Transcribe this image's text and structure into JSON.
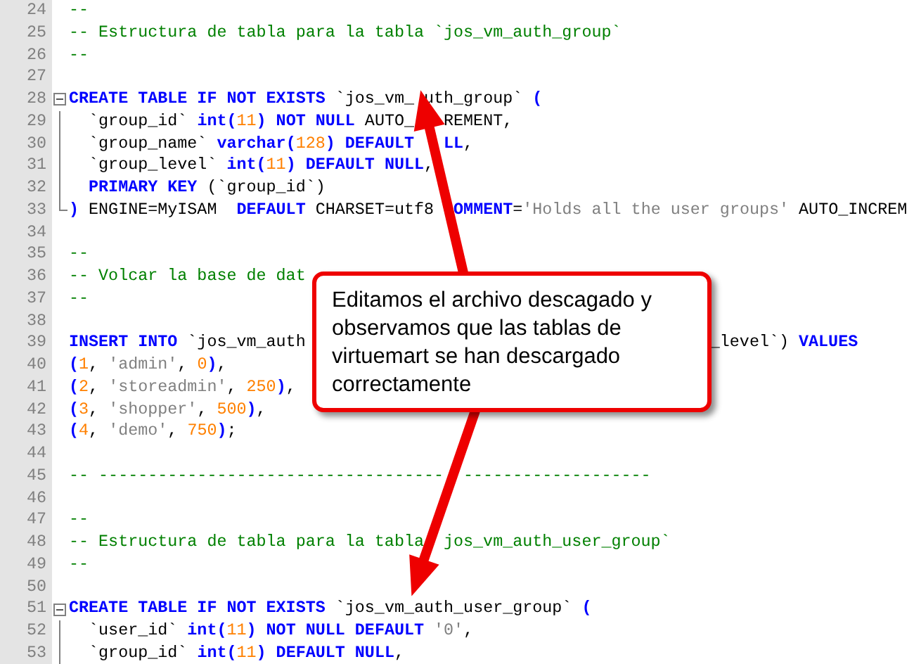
{
  "editor": {
    "lines": [
      {
        "number": "24",
        "tokens": [
          {
            "kind": "comment",
            "text": "--"
          }
        ]
      },
      {
        "number": "25",
        "tokens": [
          {
            "kind": "comment",
            "text": "-- Estructura de tabla para la tabla `jos_vm_auth_group`"
          }
        ]
      },
      {
        "number": "26",
        "tokens": [
          {
            "kind": "comment",
            "text": "--"
          }
        ]
      },
      {
        "number": "27"
      },
      {
        "number": "28",
        "fold_start": true,
        "tokens": [
          {
            "kind": "keyword",
            "text": "CREATE TABLE IF NOT EXISTS"
          },
          {
            "kind": "plain",
            "text": " `jos_vm_"
          },
          {
            "kind": "covered"
          },
          {
            "kind": "plain",
            "text": "uth_group` "
          },
          {
            "kind": "keyword",
            "text": "("
          }
        ]
      },
      {
        "number": "29",
        "fold_body": true,
        "tokens": [
          {
            "kind": "plain",
            "text": "  `group_id` "
          },
          {
            "kind": "keyword",
            "text": "int("
          },
          {
            "kind": "number",
            "text": "11"
          },
          {
            "kind": "keyword",
            "text": ") NOT NULL"
          },
          {
            "kind": "plain",
            "text": " AUTO_"
          },
          {
            "kind": "covered"
          },
          {
            "kind": "covered"
          },
          {
            "kind": "covered"
          },
          {
            "kind": "plain",
            "text": "REMENT,"
          }
        ]
      },
      {
        "number": "30",
        "fold_body": true,
        "tokens": [
          {
            "kind": "plain",
            "text": "  `group_name` "
          },
          {
            "kind": "keyword",
            "text": "varchar("
          },
          {
            "kind": "number",
            "text": "128"
          },
          {
            "kind": "keyword",
            "text": ") DEFAULT "
          },
          {
            "kind": "covered"
          },
          {
            "kind": "covered"
          },
          {
            "kind": "keyword",
            "text": "LL"
          },
          {
            "kind": "plain",
            "text": ","
          }
        ]
      },
      {
        "number": "31",
        "fold_body": true,
        "tokens": [
          {
            "kind": "plain",
            "text": "  `group_level` "
          },
          {
            "kind": "keyword",
            "text": "int("
          },
          {
            "kind": "number",
            "text": "11"
          },
          {
            "kind": "keyword",
            "text": ") DEFAULT NULL"
          },
          {
            "kind": "plain",
            "text": ","
          }
        ]
      },
      {
        "number": "32",
        "fold_body": true,
        "tokens": [
          {
            "kind": "keyword",
            "text": "  PRIMARY KEY"
          },
          {
            "kind": "plain",
            "text": " (`group_id`)"
          }
        ]
      },
      {
        "number": "33",
        "fold_end": true,
        "tokens": [
          {
            "kind": "keyword",
            "text": ")"
          },
          {
            "kind": "plain",
            "text": " ENGINE=MyISAM  "
          },
          {
            "kind": "keyword",
            "text": "DEFAULT"
          },
          {
            "kind": "plain",
            "text": " CHARSET=utf8 "
          },
          {
            "kind": "covered"
          },
          {
            "kind": "keyword",
            "text": "OMMENT"
          },
          {
            "kind": "plain",
            "text": "="
          },
          {
            "kind": "string",
            "text": "'Holds all the user groups'"
          },
          {
            "kind": "plain",
            "text": " AUTO_INCREM"
          }
        ]
      },
      {
        "number": "34"
      },
      {
        "number": "35",
        "tokens": [
          {
            "kind": "comment",
            "text": "--"
          }
        ]
      },
      {
        "number": "36",
        "tokens": [
          {
            "kind": "comment",
            "text": "-- Volcar la base de dat"
          }
        ]
      },
      {
        "number": "37",
        "tokens": [
          {
            "kind": "comment",
            "text": "--"
          }
        ]
      },
      {
        "number": "38"
      },
      {
        "number": "39",
        "tokens": [
          {
            "kind": "keyword",
            "text": "INSERT INTO"
          },
          {
            "kind": "plain",
            "text": " `jos_vm_auth"
          },
          {
            "kind": "covered_wide"
          },
          {
            "kind": "plain",
            "text": "_level`) "
          },
          {
            "kind": "keyword",
            "text": "VALUES"
          }
        ]
      },
      {
        "number": "40",
        "tokens": [
          {
            "kind": "keyword",
            "text": "("
          },
          {
            "kind": "number",
            "text": "1"
          },
          {
            "kind": "plain",
            "text": ", "
          },
          {
            "kind": "string",
            "text": "'admin'"
          },
          {
            "kind": "plain",
            "text": ", "
          },
          {
            "kind": "number",
            "text": "0"
          },
          {
            "kind": "keyword",
            "text": ")"
          },
          {
            "kind": "plain",
            "text": ","
          }
        ]
      },
      {
        "number": "41",
        "tokens": [
          {
            "kind": "keyword",
            "text": "("
          },
          {
            "kind": "number",
            "text": "2"
          },
          {
            "kind": "plain",
            "text": ", "
          },
          {
            "kind": "string",
            "text": "'storeadmin'"
          },
          {
            "kind": "plain",
            "text": ", "
          },
          {
            "kind": "number",
            "text": "250"
          },
          {
            "kind": "keyword",
            "text": ")"
          },
          {
            "kind": "plain",
            "text": ","
          }
        ]
      },
      {
        "number": "42",
        "tokens": [
          {
            "kind": "keyword",
            "text": "("
          },
          {
            "kind": "number",
            "text": "3"
          },
          {
            "kind": "plain",
            "text": ", "
          },
          {
            "kind": "string",
            "text": "'shopper'"
          },
          {
            "kind": "plain",
            "text": ", "
          },
          {
            "kind": "number",
            "text": "500"
          },
          {
            "kind": "keyword",
            "text": ")"
          },
          {
            "kind": "plain",
            "text": ","
          }
        ]
      },
      {
        "number": "43",
        "tokens": [
          {
            "kind": "keyword",
            "text": "("
          },
          {
            "kind": "number",
            "text": "4"
          },
          {
            "kind": "plain",
            "text": ", "
          },
          {
            "kind": "string",
            "text": "'demo'"
          },
          {
            "kind": "plain",
            "text": ", "
          },
          {
            "kind": "number",
            "text": "750"
          },
          {
            "kind": "keyword",
            "text": ")"
          },
          {
            "kind": "plain",
            "text": ";"
          }
        ]
      },
      {
        "number": "44"
      },
      {
        "number": "45",
        "tokens": [
          {
            "kind": "comment",
            "text": "-- -----------------------------------"
          },
          {
            "kind": "covered"
          },
          {
            "kind": "covered"
          },
          {
            "kind": "comment",
            "text": "-------------------"
          }
        ]
      },
      {
        "number": "46"
      },
      {
        "number": "47",
        "tokens": [
          {
            "kind": "comment",
            "text": "--"
          }
        ]
      },
      {
        "number": "48",
        "tokens": [
          {
            "kind": "comment",
            "text": "-- Estructura de tabla para la tabla"
          },
          {
            "kind": "covered"
          },
          {
            "kind": "covered"
          },
          {
            "kind": "comment",
            "text": "jos_vm_auth_user_group`"
          }
        ]
      },
      {
        "number": "49",
        "tokens": [
          {
            "kind": "comment",
            "text": "--"
          }
        ]
      },
      {
        "number": "50"
      },
      {
        "number": "51",
        "fold_start": true,
        "tokens": [
          {
            "kind": "keyword",
            "text": "CREATE TABLE IF NOT EXISTS"
          },
          {
            "kind": "plain",
            "text": " `jos_vm_auth_user_group` "
          },
          {
            "kind": "keyword",
            "text": "("
          }
        ]
      },
      {
        "number": "52",
        "fold_body": true,
        "tokens": [
          {
            "kind": "plain",
            "text": "  `user_id` "
          },
          {
            "kind": "keyword",
            "text": "int("
          },
          {
            "kind": "number",
            "text": "11"
          },
          {
            "kind": "keyword",
            "text": ") NOT NULL DEFAULT "
          },
          {
            "kind": "string",
            "text": "'0'"
          },
          {
            "kind": "plain",
            "text": ","
          }
        ]
      },
      {
        "number": "53",
        "fold_body": true,
        "tokens": [
          {
            "kind": "plain",
            "text": "  `group_id` "
          },
          {
            "kind": "keyword",
            "text": "int("
          },
          {
            "kind": "number",
            "text": "11"
          },
          {
            "kind": "keyword",
            "text": ") DEFAULT NULL"
          },
          {
            "kind": "plain",
            "text": ","
          }
        ]
      }
    ]
  },
  "callout": {
    "text": "Editamos el archivo descagado y observamos que las tablas de virtuemart se han descargado correctamente"
  }
}
